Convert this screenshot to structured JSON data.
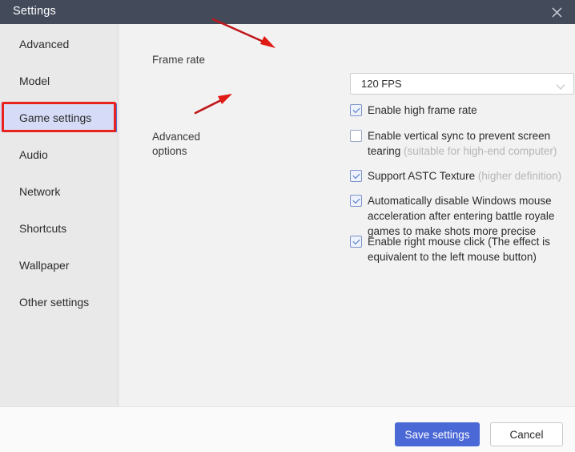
{
  "window": {
    "title": "Settings",
    "close_icon": "close-icon"
  },
  "sidebar": {
    "items": [
      {
        "label": "Advanced",
        "active": false
      },
      {
        "label": "Model",
        "active": false
      },
      {
        "label": "Game settings",
        "active": true
      },
      {
        "label": "Audio",
        "active": false
      },
      {
        "label": "Network",
        "active": false
      },
      {
        "label": "Shortcuts",
        "active": false
      },
      {
        "label": "Wallpaper",
        "active": false
      },
      {
        "label": "Other settings",
        "active": false
      }
    ]
  },
  "main": {
    "frame_rate": {
      "label": "Frame rate",
      "selected": "120 FPS",
      "caret_icon": "chevron-down-icon"
    },
    "high_frame_rate": {
      "label": "Enable high frame rate",
      "checked": true
    },
    "advanced_options": {
      "label_line1": "Advanced",
      "label_line2": "options",
      "options": [
        {
          "label": "Enable vertical sync to prevent screen tearing ",
          "hint": "(suitable for high-end computer)",
          "checked": false
        },
        {
          "label": "Support ASTC Texture ",
          "hint": "(higher definition)",
          "checked": true
        },
        {
          "label": "Automatically disable Windows mouse acceleration after entering battle royale games to make shots more precise",
          "hint": "",
          "checked": true
        },
        {
          "label": "Enable right mouse click (The effect is equivalent to the left mouse button)",
          "hint": "",
          "checked": true
        }
      ]
    }
  },
  "footer": {
    "save_label": "Save settings",
    "cancel_label": "Cancel"
  },
  "colors": {
    "titlebar": "#434b5b",
    "sidebar": "#e9e9e9",
    "content": "#f2f2f2",
    "accent": "#4a68d6",
    "active_item": "#d6dcf7",
    "active_rail": "#5b6ad0",
    "annotation_red": "#e8231e",
    "hint_text": "#b6b6b6"
  }
}
